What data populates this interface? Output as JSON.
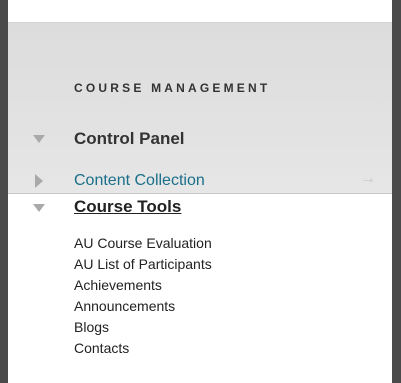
{
  "management": {
    "title": "COURSE MANAGEMENT",
    "control_panel": "Control Panel",
    "content_collection": "Content Collection",
    "arrow": "→"
  },
  "course_tools": {
    "title": "Course Tools",
    "items": [
      {
        "label": "AU Course Evaluation"
      },
      {
        "label": "AU List of Participants"
      },
      {
        "label": "Achievements"
      },
      {
        "label": "Announcements"
      },
      {
        "label": "Blogs"
      },
      {
        "label": "Contacts"
      }
    ]
  },
  "colors": {
    "link": "#1a6f8a",
    "caret": "#a9a9a9",
    "panel_bg": "#dcdcdc",
    "frame": "#4a4a4a"
  }
}
